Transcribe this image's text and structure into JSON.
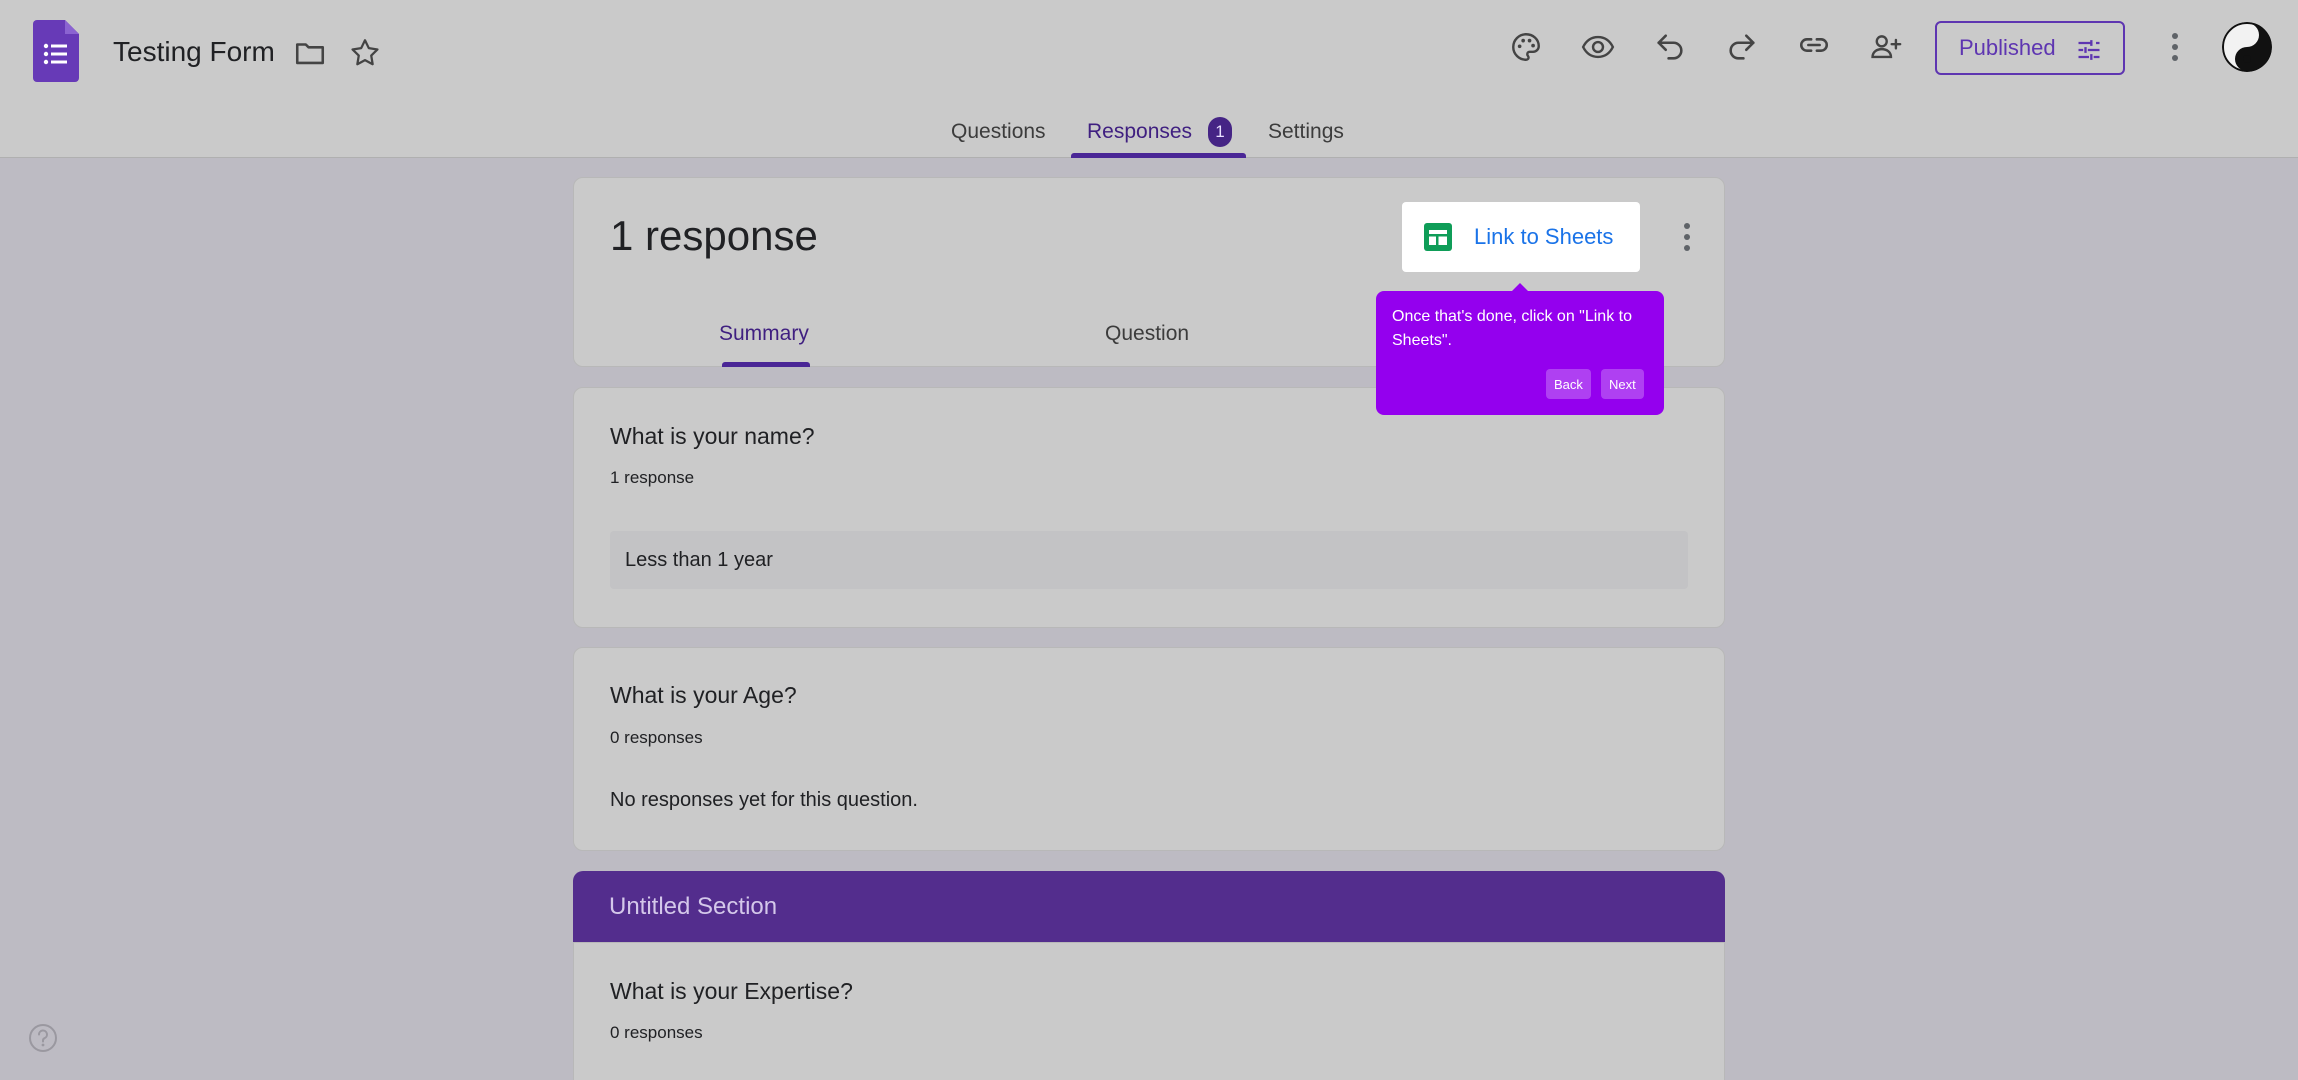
{
  "app": {
    "form_title": "Testing Form"
  },
  "header": {
    "publish_label": "Published",
    "icons": [
      "forms-logo-icon",
      "folder-icon",
      "star-icon",
      "palette-icon",
      "eye-icon",
      "undo-icon",
      "redo-icon",
      "link-icon",
      "add-person-icon",
      "tune-icon",
      "more-vert-icon",
      "avatar"
    ]
  },
  "tabs": [
    {
      "label": "Questions"
    },
    {
      "label": "Responses",
      "badge": "1"
    },
    {
      "label": "Settings"
    }
  ],
  "responses_card": {
    "title": "1 response",
    "link_label": "Link to Sheets",
    "sub_tabs": [
      {
        "label": "Summary"
      },
      {
        "label": "Question"
      }
    ]
  },
  "tooltip": {
    "message": "Once that's done, click on \"Link to Sheets\".",
    "back_label": "Back",
    "next_label": "Next"
  },
  "questions": [
    {
      "title": "What is your name?",
      "count": "1 response",
      "answer": "Less than 1 year"
    },
    {
      "title": "What is your Age?",
      "count": "0 responses",
      "empty": "No responses yet for this question."
    }
  ],
  "section": {
    "title": "Untitled Section",
    "question": {
      "title": "What is your Expertise?",
      "count": "0 responses"
    }
  },
  "colors": {
    "accent": "#5e35b1",
    "tooltip": "#9400ee",
    "section_header": "#532d8d",
    "sheets_green": "#0f9d58",
    "link_blue": "#1a73e8"
  }
}
